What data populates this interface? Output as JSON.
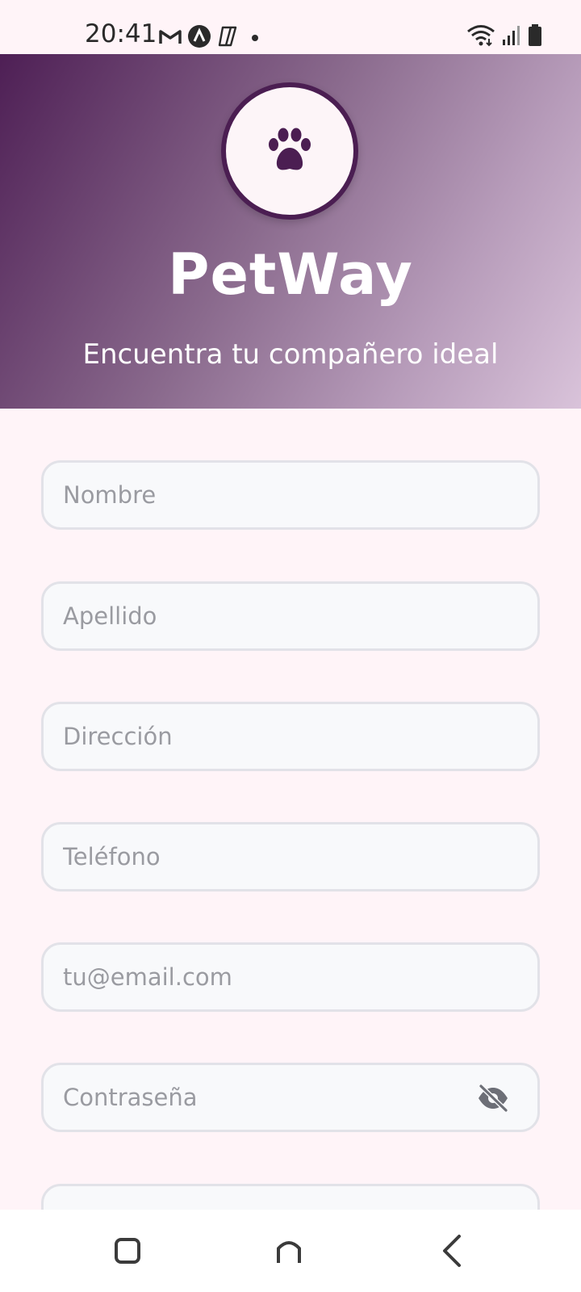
{
  "status_bar": {
    "time": "20:41",
    "left_icons": [
      "gmail-icon",
      "app-a-icon",
      "app-copilot-icon",
      "dot-icon"
    ],
    "right_icons": [
      "wifi-icon",
      "signal-icon",
      "battery-icon"
    ]
  },
  "header": {
    "logo_icon": "paw-icon",
    "title": "PetWay",
    "subtitle": "Encuentra tu compañero ideal",
    "gradient_colors": [
      "#4e1f55",
      "#d9c3da"
    ]
  },
  "form": {
    "fields": [
      {
        "placeholder": "Nombre"
      },
      {
        "placeholder": "Apellido"
      },
      {
        "placeholder": "Dirección"
      },
      {
        "placeholder": "Teléfono"
      },
      {
        "placeholder": "tu@email.com"
      },
      {
        "placeholder": "Contraseña",
        "trailing_icon": "eye-off-icon"
      }
    ]
  },
  "nav_bar": {
    "buttons": [
      "recents-icon",
      "home-icon",
      "back-icon"
    ]
  },
  "colors": {
    "background": "#fff4f8",
    "accent": "#4b1e52",
    "field_border": "#e2e2e8",
    "placeholder": "#9a9ba1"
  }
}
